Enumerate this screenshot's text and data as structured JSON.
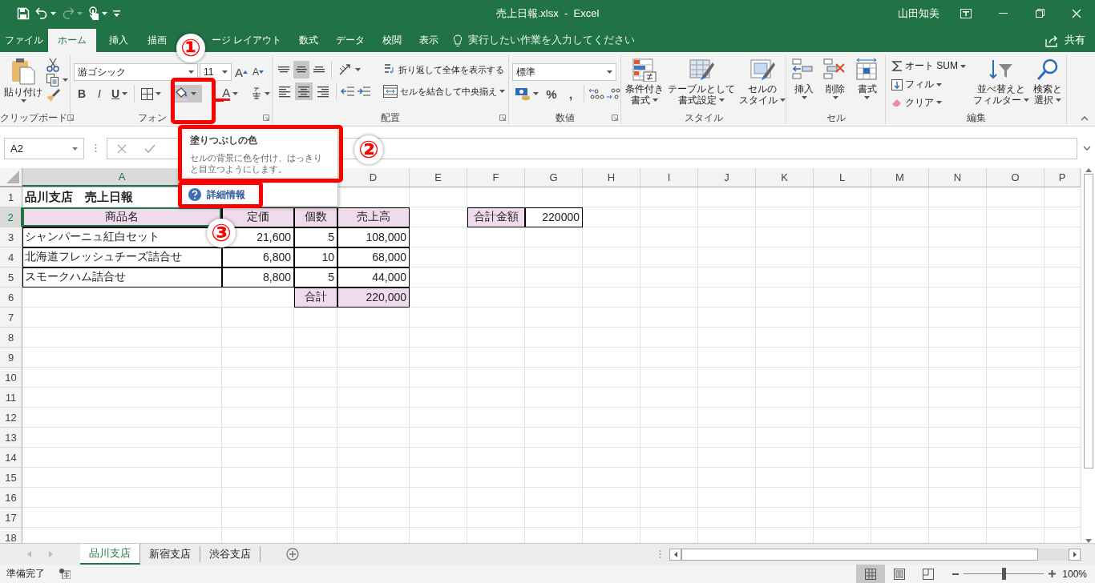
{
  "title_bar": {
    "title": "売上日報.xlsx  -  Excel",
    "user": "山田知美"
  },
  "menu_tabs": [
    {
      "label": "ファイル",
      "selected": false
    },
    {
      "label": "ホーム",
      "selected": true
    },
    {
      "label": "挿入",
      "selected": false
    },
    {
      "label": "描画",
      "selected": false
    },
    {
      "label": "ージ レイアウト",
      "selected": false
    },
    {
      "label": "数式",
      "selected": false
    },
    {
      "label": "データ",
      "selected": false
    },
    {
      "label": "校閲",
      "selected": false
    },
    {
      "label": "表示",
      "selected": false
    }
  ],
  "tell_me": {
    "label": "実行したい作業を入力してください"
  },
  "share": {
    "label": "共有"
  },
  "ribbon": {
    "clipboard": {
      "paste": "貼り付け",
      "label": "クリップボード"
    },
    "font": {
      "font_name": "游ゴシック",
      "font_size": "11",
      "grow": "A",
      "shrink": "A",
      "bold": "B",
      "italic": "I",
      "underline": "U",
      "font_color": "A",
      "fill_color_hovered": true,
      "label": "フォン"
    },
    "alignment": {
      "vertical": [
        {
          "kind": "top",
          "selected": false
        },
        {
          "kind": "middle",
          "selected": true
        },
        {
          "kind": "bottom",
          "selected": false
        }
      ],
      "horizontal": [
        {
          "kind": "left",
          "selected": false
        },
        {
          "kind": "center",
          "selected": true
        },
        {
          "kind": "right",
          "selected": false
        }
      ],
      "wrap_text": "折り返して全体を表示する",
      "merge": "セルを結合して中央揃え",
      "label": "配置"
    },
    "number": {
      "format": "標準",
      "percent": "%",
      "comma": ",",
      "label": "数値"
    },
    "styles": {
      "buttons": [
        {
          "kind": "conditional",
          "lines": [
            "条件付き",
            "書式"
          ]
        },
        {
          "kind": "table",
          "lines": [
            "テーブルとして",
            "書式設定"
          ]
        },
        {
          "kind": "cell_style",
          "lines": [
            "セルの",
            "スタイル"
          ]
        }
      ],
      "label": "スタイル"
    },
    "cells": {
      "buttons": [
        {
          "kind": "insert",
          "lines": [
            "挿入"
          ]
        },
        {
          "kind": "delete",
          "lines": [
            "削除"
          ]
        },
        {
          "kind": "format",
          "lines": [
            "書式"
          ]
        }
      ],
      "label": "セル"
    },
    "editing": {
      "autosum": "オート SUM",
      "fill": "フィル",
      "clear": "クリア",
      "sort": [
        "並べ替えと",
        "フィルター"
      ],
      "find": [
        "検索と",
        "選択"
      ],
      "label": "編集"
    }
  },
  "formula_bar": {
    "name_box": "A2"
  },
  "tooltip": {
    "title": "塗りつぶしの色",
    "description": "セルの背景に色を付け、はっきりと目立つようにします。",
    "more": "詳細情報"
  },
  "sheet": {
    "columns": [
      {
        "label": "A",
        "selected": true
      },
      {
        "label": "D",
        "selected": false
      },
      {
        "label": "E",
        "selected": false
      },
      {
        "label": "F",
        "selected": false
      },
      {
        "label": "G",
        "selected": false
      },
      {
        "label": "H",
        "selected": false
      },
      {
        "label": "I",
        "selected": false
      },
      {
        "label": "J",
        "selected": false
      },
      {
        "label": "K",
        "selected": false
      },
      {
        "label": "L",
        "selected": false
      },
      {
        "label": "M",
        "selected": false
      },
      {
        "label": "N",
        "selected": false
      },
      {
        "label": "O",
        "selected": false
      },
      {
        "label": "P",
        "selected": false
      }
    ],
    "rows": [
      {
        "label": "1",
        "selected": false,
        "cells": [
          {
            "kind": "title",
            "text": "品川支店　売上日報",
            "selected": false
          }
        ]
      },
      {
        "label": "2",
        "selected": true,
        "cells": [
          {
            "kind": "header",
            "text": "商品名",
            "selected": true
          },
          {
            "kind": "header",
            "text": "定価",
            "selected": false
          },
          {
            "kind": "header",
            "text": "個数",
            "selected": false
          },
          {
            "kind": "header",
            "text": "売上高",
            "selected": false
          },
          {
            "kind": "empty",
            "selected": false
          },
          {
            "kind": "header",
            "text": "合計金額",
            "selected": false
          },
          {
            "kind": "number",
            "text": "220000",
            "selected": false
          }
        ]
      },
      {
        "label": "3",
        "selected": false,
        "cells": [
          {
            "kind": "text",
            "text": "シャンパーニュ紅白セット",
            "selected": false
          },
          {
            "kind": "number",
            "text": "21,600",
            "selected": false
          },
          {
            "kind": "number",
            "text": "5",
            "selected": false
          },
          {
            "kind": "number",
            "text": "108,000",
            "selected": false
          }
        ]
      },
      {
        "label": "4",
        "selected": false,
        "cells": [
          {
            "kind": "text",
            "text": "北海道フレッシュチーズ詰合せ",
            "selected": false
          },
          {
            "kind": "number",
            "text": "6,800",
            "selected": false
          },
          {
            "kind": "number",
            "text": "10",
            "selected": false
          },
          {
            "kind": "number",
            "text": "68,000",
            "selected": false
          }
        ]
      },
      {
        "label": "5",
        "selected": false,
        "cells": [
          {
            "kind": "text",
            "text": "スモークハム詰合せ",
            "selected": false
          },
          {
            "kind": "number",
            "text": "8,800",
            "selected": false
          },
          {
            "kind": "number",
            "text": "5",
            "selected": false
          },
          {
            "kind": "number",
            "text": "44,000",
            "selected": false
          }
        ]
      },
      {
        "label": "6",
        "selected": false,
        "cells": [
          {
            "kind": "empty",
            "selected": false
          },
          {
            "kind": "empty",
            "selected": false
          },
          {
            "kind": "header",
            "text": "合計",
            "selected": false
          },
          {
            "kind": "total",
            "text": "220,000",
            "selected": false
          }
        ]
      },
      {
        "label": "7",
        "selected": false
      },
      {
        "label": "8",
        "selected": false
      },
      {
        "label": "9",
        "selected": false
      },
      {
        "label": "10",
        "selected": false
      },
      {
        "label": "11",
        "selected": false
      },
      {
        "label": "12",
        "selected": false
      },
      {
        "label": "13",
        "selected": false
      },
      {
        "label": "14",
        "selected": false
      },
      {
        "label": "15",
        "selected": false
      },
      {
        "label": "16",
        "selected": false
      },
      {
        "label": "17",
        "selected": false
      },
      {
        "label": "18",
        "selected": false
      }
    ]
  },
  "sheet_tabs": [
    {
      "label": "品川支店",
      "selected": true
    },
    {
      "label": "新宿支店",
      "selected": false
    },
    {
      "label": "渋谷支店",
      "selected": false
    }
  ],
  "status_bar": {
    "status": "準備完了",
    "views": [
      {
        "kind": "normal",
        "selected": true
      },
      {
        "kind": "page_layout",
        "selected": false
      },
      {
        "kind": "page_break",
        "selected": false
      }
    ],
    "zoom": {
      "level": 0.5
    },
    "zoom_label": "100%"
  },
  "annotations": [
    {
      "label": "①"
    },
    {
      "label": "②"
    },
    {
      "label": "③"
    }
  ]
}
